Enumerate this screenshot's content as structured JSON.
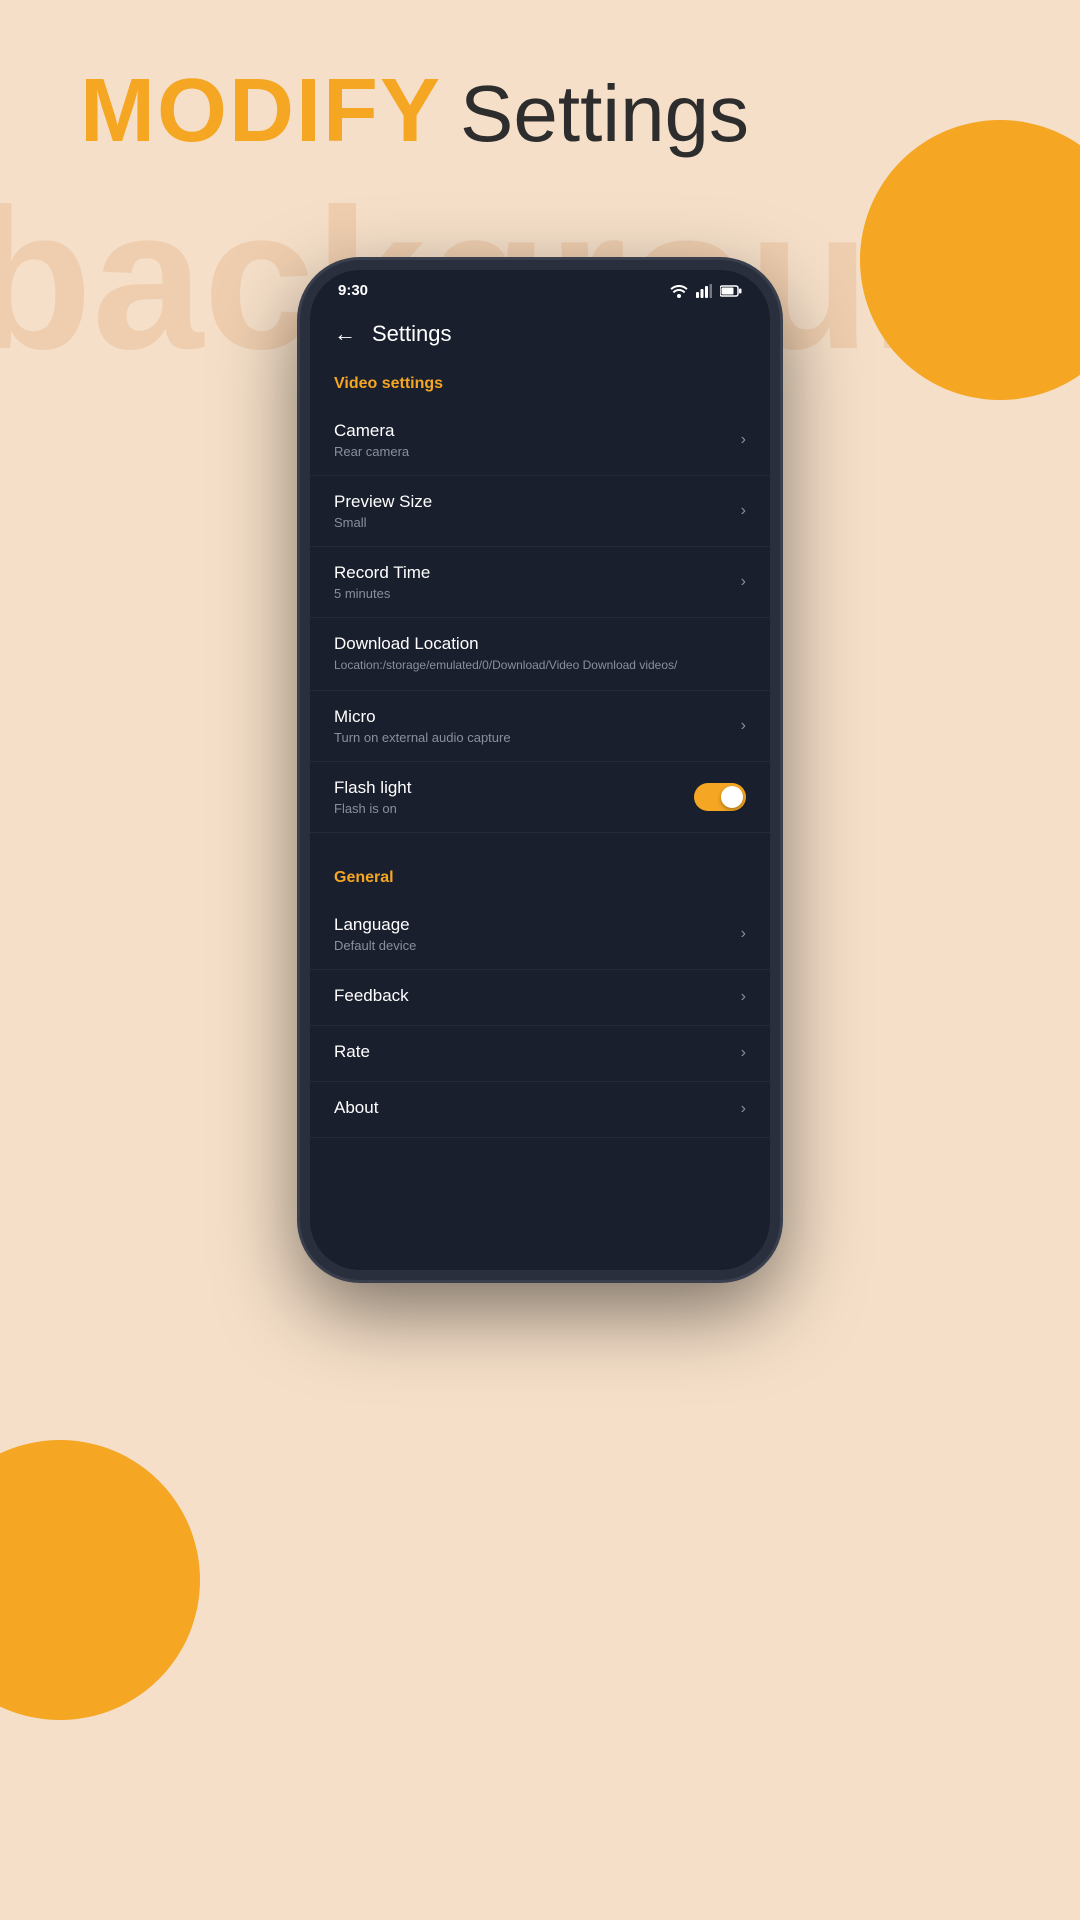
{
  "page": {
    "background_color": "#f5dfc8",
    "accent_color": "#f5a623"
  },
  "header": {
    "modify_label": "MODIFY",
    "settings_label": "Settings",
    "bg_text": "background"
  },
  "phone": {
    "status_bar": {
      "time": "9:30"
    },
    "nav": {
      "back_label": "←",
      "title": "Settings"
    },
    "video_section": {
      "label": "Video settings",
      "items": [
        {
          "title": "Camera",
          "subtitle": "Rear camera",
          "type": "chevron"
        },
        {
          "title": "Preview Size",
          "subtitle": "Small",
          "type": "chevron"
        },
        {
          "title": "Record Time",
          "subtitle": "5 minutes",
          "type": "chevron"
        },
        {
          "title": "Download Location",
          "subtitle": "Location:/storage/emulated/0/Download/Video Download videos/",
          "type": "none"
        },
        {
          "title": "Micro",
          "subtitle": "Turn on external audio capture",
          "type": "chevron"
        },
        {
          "title": "Flash light",
          "subtitle": "Flash is on",
          "type": "toggle",
          "toggle_on": true
        }
      ]
    },
    "general_section": {
      "label": "General",
      "items": [
        {
          "title": "Language",
          "subtitle": "Default device",
          "type": "chevron"
        },
        {
          "title": "Feedback",
          "subtitle": "",
          "type": "chevron"
        },
        {
          "title": "Rate",
          "subtitle": "",
          "type": "chevron"
        },
        {
          "title": "About",
          "subtitle": "",
          "type": "chevron"
        }
      ]
    }
  }
}
